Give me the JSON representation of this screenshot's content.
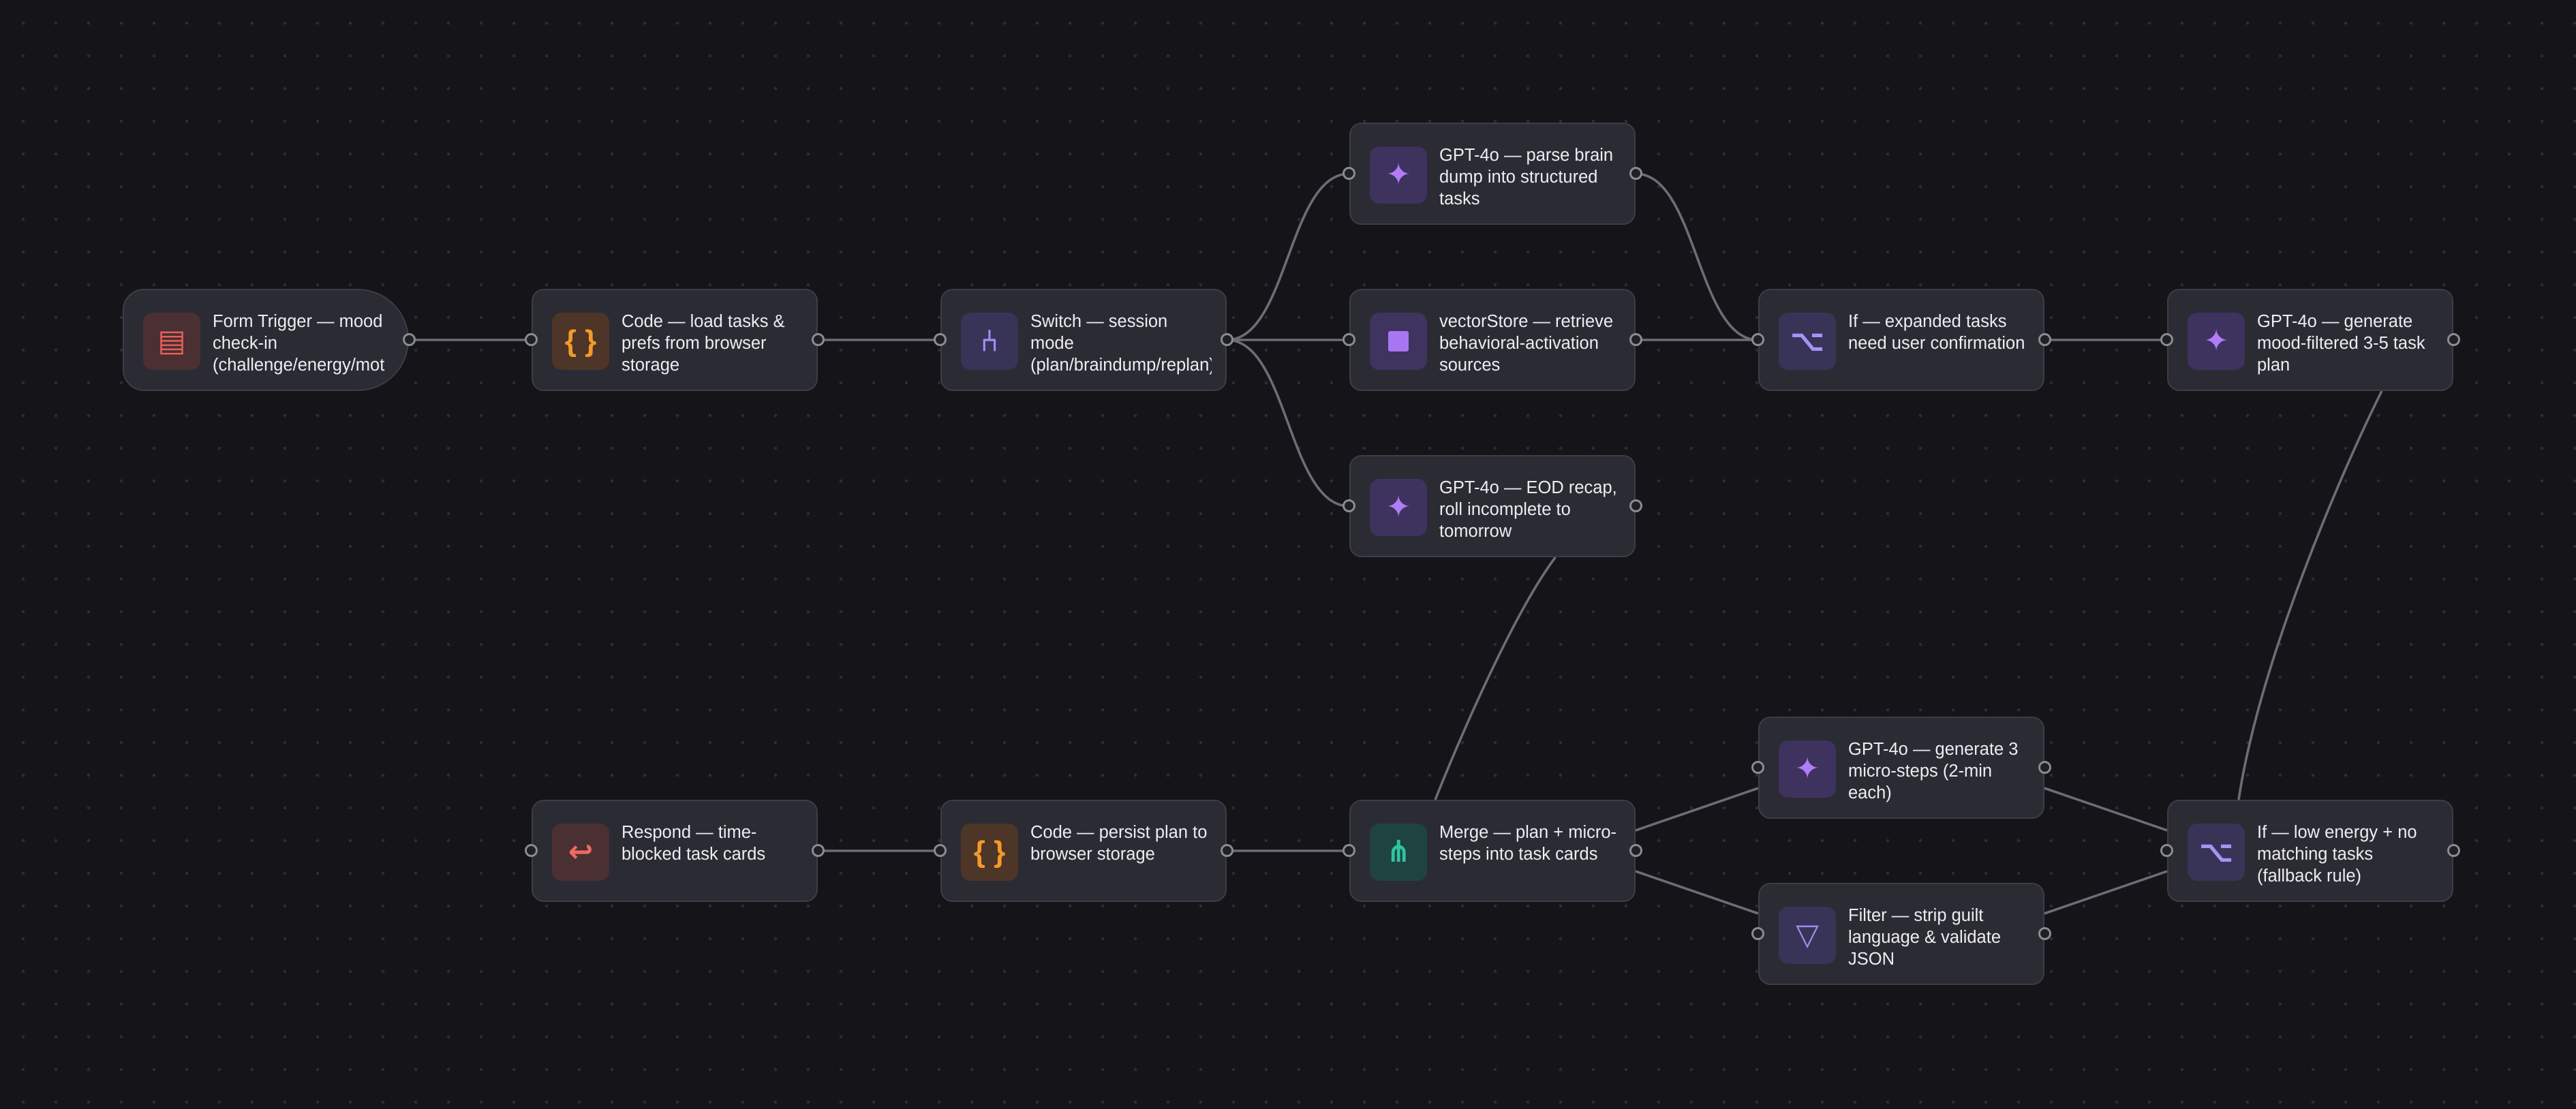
{
  "nodes": {
    "form_trigger": {
      "label": "Form Trigger — mood check-in (challenge/energy/mot",
      "icon": "form-icon",
      "category": "trigger"
    },
    "code_load": {
      "label": "Code — load tasks & prefs from browser storage",
      "icon": "code-braces-icon",
      "category": "code"
    },
    "switch_mode": {
      "label": "Switch — session mode (plan/braindump/replan)",
      "icon": "switch-branch-icon",
      "category": "switch"
    },
    "gpt_parse": {
      "label": "GPT-4o — parse brain dump into structured tasks",
      "icon": "ai-sparkle-icon",
      "category": "ai"
    },
    "vector_store": {
      "label": "vectorStore — retrieve behavioral-activation sources",
      "icon": "vector-store-icon",
      "category": "vector"
    },
    "gpt_eod": {
      "label": "GPT-4o — EOD recap, roll incomplete to tomorrow",
      "icon": "ai-sparkle-icon",
      "category": "ai"
    },
    "if_expanded": {
      "label": "If — expanded tasks need user confirmation",
      "icon": "if-branch-icon",
      "category": "if"
    },
    "gpt_plan": {
      "label": "GPT-4o — generate mood-filtered 3-5 task plan",
      "icon": "ai-sparkle-icon",
      "category": "ai"
    },
    "respond": {
      "label": "Respond — time-blocked task cards",
      "icon": "respond-return-icon",
      "category": "respond"
    },
    "code_persist": {
      "label": "Code — persist plan to browser storage",
      "icon": "code-braces-icon",
      "category": "code"
    },
    "merge": {
      "label": "Merge — plan + micro-steps into task cards",
      "icon": "merge-icon",
      "category": "merge"
    },
    "gpt_micro": {
      "label": "GPT-4o — generate 3 micro-steps (2-min each)",
      "icon": "ai-sparkle-icon",
      "category": "ai"
    },
    "filter_guilt": {
      "label": "Filter — strip guilt language & validate JSON",
      "icon": "filter-funnel-icon",
      "category": "filter"
    },
    "if_low_energy": {
      "label": "If — low energy + no matching tasks (fallback rule)",
      "icon": "if-branch-icon",
      "category": "if"
    }
  },
  "icon_glyphs": {
    "form-icon": "▤",
    "code-braces-icon": "{ }",
    "switch-branch-icon": "⑃",
    "ai-sparkle-icon": "✦",
    "if-branch-icon": "⌥",
    "respond-return-icon": "↩",
    "merge-icon": "⋔",
    "filter-funnel-icon": "▽"
  },
  "connections": [
    {
      "from": "form_trigger",
      "to": "code_load"
    },
    {
      "from": "code_load",
      "to": "switch_mode"
    },
    {
      "from": "switch_mode",
      "to": "gpt_parse"
    },
    {
      "from": "switch_mode",
      "to": "vector_store"
    },
    {
      "from": "switch_mode",
      "to": "gpt_eod"
    },
    {
      "from": "gpt_parse",
      "to": "if_expanded"
    },
    {
      "from": "vector_store",
      "to": "if_expanded"
    },
    {
      "from": "if_expanded",
      "to": "gpt_plan"
    },
    {
      "from": "gpt_plan",
      "to": "if_low_energy"
    },
    {
      "from": "if_low_energy",
      "to": "gpt_micro"
    },
    {
      "from": "if_low_energy",
      "to": "filter_guilt"
    },
    {
      "from": "gpt_micro",
      "to": "merge"
    },
    {
      "from": "filter_guilt",
      "to": "merge"
    },
    {
      "from": "gpt_eod",
      "to": "merge"
    },
    {
      "from": "merge",
      "to": "code_persist"
    },
    {
      "from": "code_persist",
      "to": "respond"
    }
  ]
}
